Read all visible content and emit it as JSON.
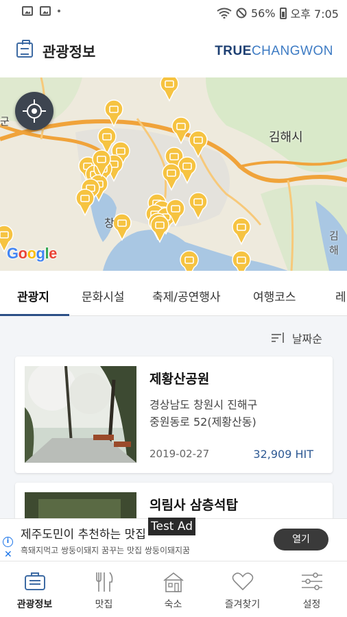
{
  "status_bar": {
    "battery": "56%",
    "time": "오후 7:05"
  },
  "header": {
    "title": "관광정보",
    "brand_primary": "TRUE",
    "brand_secondary": "CHANGWON"
  },
  "map": {
    "labels": {
      "gimhae": "김해시",
      "left_edge": "군",
      "chang": "창",
      "right_edge": "김해"
    },
    "google": "Google"
  },
  "tabs": [
    "관광지",
    "문화시설",
    "축제/공연행사",
    "여행코스",
    "레"
  ],
  "sort": {
    "label": "날짜순"
  },
  "cards": [
    {
      "title": "제황산공원",
      "address_line1": "경상남도 창원시 진해구",
      "address_line2": "중원동로 52(제황산동)",
      "date": "2019-02-27",
      "hits": "32,909 HIT"
    },
    {
      "title": "의림사 삼층석탑"
    }
  ],
  "ad": {
    "badge": "Test Ad",
    "headline": "제주도민이 추천하는 맛집",
    "subline": "흑돼지먹고 쌍둥이돼지 꿈꾸는 맛집 쌍둥이돼지꿈",
    "cta": "열기",
    "info_icon": "i",
    "close_icon": "✕"
  },
  "bottom_nav": [
    {
      "label": "관광정보",
      "icon": "briefcase-icon"
    },
    {
      "label": "맛집",
      "icon": "utensils-icon"
    },
    {
      "label": "숙소",
      "icon": "house-icon"
    },
    {
      "label": "즐겨찾기",
      "icon": "heart-icon"
    },
    {
      "label": "설정",
      "icon": "sliders-icon"
    }
  ],
  "colors": {
    "accent": "#2b4f86",
    "brand_dark": "#1d3f72",
    "brand_light": "#3d7bc4",
    "marker": "#f6c341",
    "road": "#f0a33a"
  }
}
